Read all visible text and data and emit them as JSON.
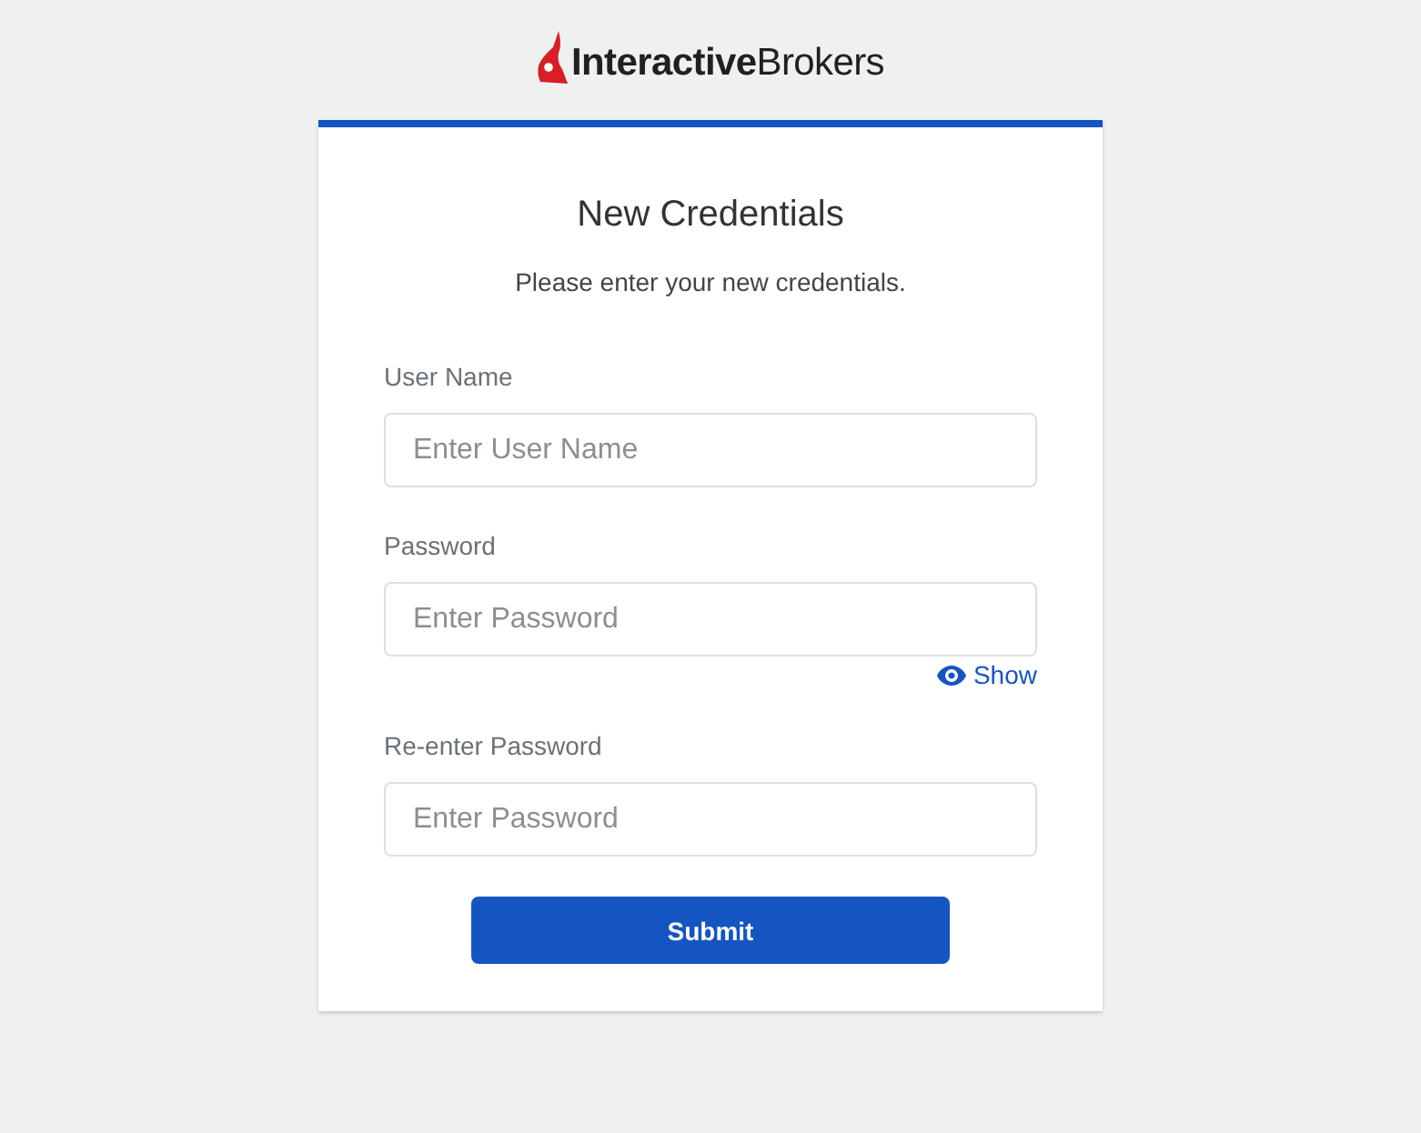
{
  "logo": {
    "text": "**Interactive**Brokers"
  },
  "card": {
    "title": "New Credentials",
    "subtitle": "Please enter your new credentials.",
    "fields": [
      {
        "label": "User Name",
        "placeholder": "Enter User Name"
      },
      {
        "label": "Password",
        "placeholder": "Enter Password",
        "toggle": "Show"
      },
      {
        "label": "Re-enter Password",
        "placeholder": "Enter Password"
      }
    ],
    "submit": "Submit"
  }
}
